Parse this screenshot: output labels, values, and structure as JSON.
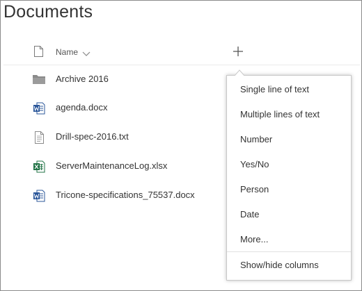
{
  "page": {
    "title": "Documents"
  },
  "header": {
    "name_label": "Name",
    "add_column_icon": "plus-icon"
  },
  "files": [
    {
      "icon": "folder-icon",
      "name": "Archive 2016"
    },
    {
      "icon": "word-icon",
      "name": "agenda.docx"
    },
    {
      "icon": "text-file-icon",
      "name": "Drill-spec-2016.txt"
    },
    {
      "icon": "excel-icon",
      "name": "ServerMaintenanceLog.xlsx"
    },
    {
      "icon": "word-icon",
      "name": "Tricone-specifications_75537.docx"
    }
  ],
  "menu": {
    "items": [
      "Single line of text",
      "Multiple lines of text",
      "Number",
      "Yes/No",
      "Person",
      "Date",
      "More..."
    ],
    "footer": "Show/hide columns"
  },
  "colors": {
    "word": "#2b579a",
    "excel": "#217346",
    "folder": "#8a8a8a",
    "text": "#333333"
  }
}
